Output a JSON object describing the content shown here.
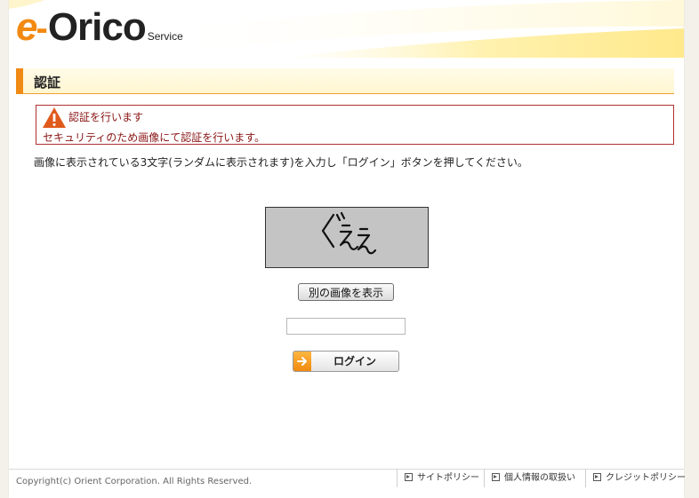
{
  "logo": {
    "e": "e",
    "dash": "-",
    "brand": "Orico",
    "service": "Service"
  },
  "section": {
    "title": "認証"
  },
  "alert": {
    "title": "認証を行います",
    "body": "セキュリティのため画像にて認証を行います。"
  },
  "instruction": "画像に表示されている3文字(ランダムに表示されます)を入力し「ログイン」ボタンを押してください。",
  "captcha": {
    "text": "ぐええ",
    "background": "#c4c4c4"
  },
  "refresh_button": {
    "label": "別の画像を表示"
  },
  "captcha_input": {
    "value": ""
  },
  "login_button": {
    "label": "ログイン"
  },
  "footer": {
    "copyright": "Copyright(c) Orient Corporation. All Rights Reserved.",
    "links": [
      "サイトポリシー",
      "個人情報の取扱い",
      "クレジットポリシー"
    ]
  },
  "colors": {
    "accent": "#f08a14",
    "alert": "#8a1414",
    "heading_bg": "#fff6d0"
  }
}
